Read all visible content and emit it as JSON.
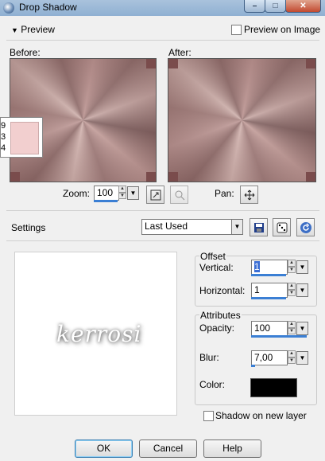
{
  "window": {
    "title": "Drop Shadow",
    "controls": {
      "minimize": "–",
      "maximize": "□",
      "close": "✕"
    }
  },
  "preview": {
    "toggle_label": "Preview",
    "preview_on_image_label": "Preview on Image",
    "before_label": "Before:",
    "after_label": "After:",
    "zoom_label": "Zoom:",
    "zoom_value": "100",
    "pan_label": "Pan:",
    "color_tooltip": {
      "numbers": [
        "9",
        "3",
        "4"
      ],
      "color": "#f2cfcf"
    }
  },
  "settings": {
    "label": "Settings",
    "preset_value": "Last Used"
  },
  "offset": {
    "group_label": "Offset",
    "vertical_label": "Vertical:",
    "vertical_value": "1",
    "horizontal_label": "Horizontal:",
    "horizontal_value": "1"
  },
  "attributes": {
    "group_label": "Attributes",
    "opacity_label": "Opacity:",
    "opacity_value": "100",
    "blur_label": "Blur:",
    "blur_value": "7,00",
    "color_label": "Color:",
    "color_value": "#000000"
  },
  "shadow_on_new_layer_label": "Shadow on new layer",
  "watermark_text": "kerrosi",
  "buttons": {
    "ok": "OK",
    "cancel": "Cancel",
    "help": "Help"
  }
}
